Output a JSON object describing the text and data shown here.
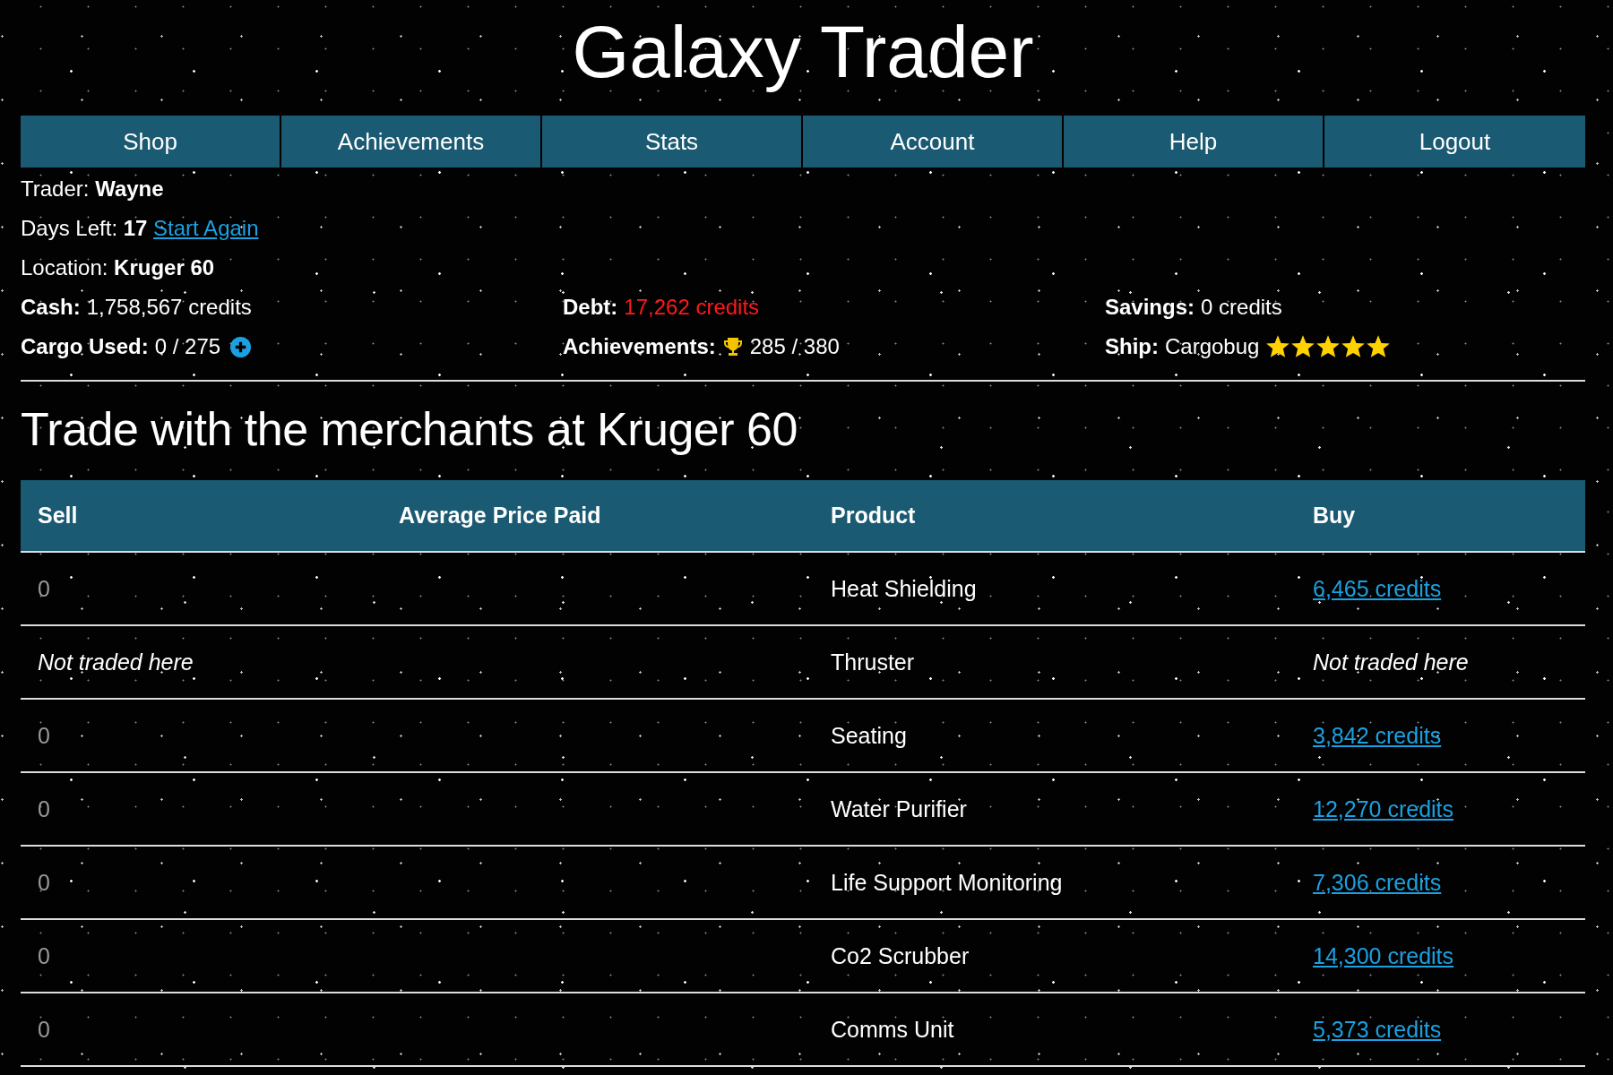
{
  "title": "Galaxy Trader",
  "nav": [
    {
      "label": "Shop"
    },
    {
      "label": "Achievements"
    },
    {
      "label": "Stats"
    },
    {
      "label": "Account"
    },
    {
      "label": "Help"
    },
    {
      "label": "Logout"
    }
  ],
  "trader": {
    "label": "Trader:",
    "value": "Wayne"
  },
  "days_left": {
    "label": "Days Left:",
    "value": "17",
    "link": "Start Again"
  },
  "location": {
    "label": "Location:",
    "value": "Kruger 60"
  },
  "stats": [
    {
      "kind": "plain",
      "label": "Cash:",
      "value": "1,758,567 credits",
      "alert": false
    },
    {
      "kind": "plain",
      "label": "Debt:",
      "value": "17,262 credits",
      "alert": true
    },
    {
      "kind": "plain",
      "label": "Savings:",
      "value": "0 credits",
      "alert": false
    },
    {
      "kind": "cargo",
      "label": "Cargo Used:",
      "value": "0 / 275",
      "alert": false
    },
    {
      "kind": "achievements",
      "label": "Achievements:",
      "value": "285 / 380",
      "alert": false
    },
    {
      "kind": "ship",
      "label": "Ship:",
      "value": "Cargobug",
      "alert": false,
      "stars": 5
    }
  ],
  "heading": "Trade with the merchants at Kruger 60",
  "table": {
    "columns": [
      "Sell",
      "Average Price Paid",
      "Product",
      "Buy"
    ],
    "rows": [
      {
        "traded": true,
        "sell": "0",
        "product": "Heat Shielding",
        "buy": "6,465 credits"
      },
      {
        "traded": false,
        "sell": "Not traded here",
        "product": "Thruster",
        "buy": "Not traded here"
      },
      {
        "traded": true,
        "sell": "0",
        "product": "Seating",
        "buy": "3,842 credits"
      },
      {
        "traded": true,
        "sell": "0",
        "product": "Water Purifier",
        "buy": "12,270 credits"
      },
      {
        "traded": true,
        "sell": "0",
        "product": "Life Support Monitoring",
        "buy": "7,306 credits"
      },
      {
        "traded": true,
        "sell": "0",
        "product": "Co2 Scrubber",
        "buy": "14,300 credits"
      },
      {
        "traded": true,
        "sell": "0",
        "product": "Comms Unit",
        "buy": "5,373 credits"
      }
    ]
  }
}
